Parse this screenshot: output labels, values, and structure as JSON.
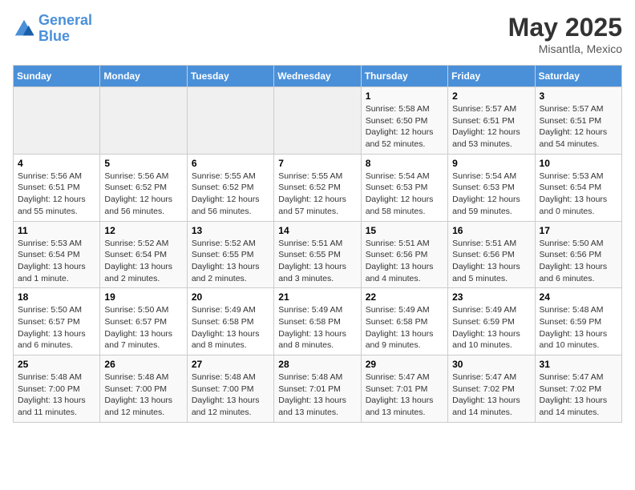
{
  "header": {
    "logo_line1": "General",
    "logo_line2": "Blue",
    "month_year": "May 2025",
    "location": "Misantla, Mexico"
  },
  "weekdays": [
    "Sunday",
    "Monday",
    "Tuesday",
    "Wednesday",
    "Thursday",
    "Friday",
    "Saturday"
  ],
  "weeks": [
    [
      {
        "day": "",
        "info": ""
      },
      {
        "day": "",
        "info": ""
      },
      {
        "day": "",
        "info": ""
      },
      {
        "day": "",
        "info": ""
      },
      {
        "day": "1",
        "info": "Sunrise: 5:58 AM\nSunset: 6:50 PM\nDaylight: 12 hours\nand 52 minutes."
      },
      {
        "day": "2",
        "info": "Sunrise: 5:57 AM\nSunset: 6:51 PM\nDaylight: 12 hours\nand 53 minutes."
      },
      {
        "day": "3",
        "info": "Sunrise: 5:57 AM\nSunset: 6:51 PM\nDaylight: 12 hours\nand 54 minutes."
      }
    ],
    [
      {
        "day": "4",
        "info": "Sunrise: 5:56 AM\nSunset: 6:51 PM\nDaylight: 12 hours\nand 55 minutes."
      },
      {
        "day": "5",
        "info": "Sunrise: 5:56 AM\nSunset: 6:52 PM\nDaylight: 12 hours\nand 56 minutes."
      },
      {
        "day": "6",
        "info": "Sunrise: 5:55 AM\nSunset: 6:52 PM\nDaylight: 12 hours\nand 56 minutes."
      },
      {
        "day": "7",
        "info": "Sunrise: 5:55 AM\nSunset: 6:52 PM\nDaylight: 12 hours\nand 57 minutes."
      },
      {
        "day": "8",
        "info": "Sunrise: 5:54 AM\nSunset: 6:53 PM\nDaylight: 12 hours\nand 58 minutes."
      },
      {
        "day": "9",
        "info": "Sunrise: 5:54 AM\nSunset: 6:53 PM\nDaylight: 12 hours\nand 59 minutes."
      },
      {
        "day": "10",
        "info": "Sunrise: 5:53 AM\nSunset: 6:54 PM\nDaylight: 13 hours\nand 0 minutes."
      }
    ],
    [
      {
        "day": "11",
        "info": "Sunrise: 5:53 AM\nSunset: 6:54 PM\nDaylight: 13 hours\nand 1 minute."
      },
      {
        "day": "12",
        "info": "Sunrise: 5:52 AM\nSunset: 6:54 PM\nDaylight: 13 hours\nand 2 minutes."
      },
      {
        "day": "13",
        "info": "Sunrise: 5:52 AM\nSunset: 6:55 PM\nDaylight: 13 hours\nand 2 minutes."
      },
      {
        "day": "14",
        "info": "Sunrise: 5:51 AM\nSunset: 6:55 PM\nDaylight: 13 hours\nand 3 minutes."
      },
      {
        "day": "15",
        "info": "Sunrise: 5:51 AM\nSunset: 6:56 PM\nDaylight: 13 hours\nand 4 minutes."
      },
      {
        "day": "16",
        "info": "Sunrise: 5:51 AM\nSunset: 6:56 PM\nDaylight: 13 hours\nand 5 minutes."
      },
      {
        "day": "17",
        "info": "Sunrise: 5:50 AM\nSunset: 6:56 PM\nDaylight: 13 hours\nand 6 minutes."
      }
    ],
    [
      {
        "day": "18",
        "info": "Sunrise: 5:50 AM\nSunset: 6:57 PM\nDaylight: 13 hours\nand 6 minutes."
      },
      {
        "day": "19",
        "info": "Sunrise: 5:50 AM\nSunset: 6:57 PM\nDaylight: 13 hours\nand 7 minutes."
      },
      {
        "day": "20",
        "info": "Sunrise: 5:49 AM\nSunset: 6:58 PM\nDaylight: 13 hours\nand 8 minutes."
      },
      {
        "day": "21",
        "info": "Sunrise: 5:49 AM\nSunset: 6:58 PM\nDaylight: 13 hours\nand 8 minutes."
      },
      {
        "day": "22",
        "info": "Sunrise: 5:49 AM\nSunset: 6:58 PM\nDaylight: 13 hours\nand 9 minutes."
      },
      {
        "day": "23",
        "info": "Sunrise: 5:49 AM\nSunset: 6:59 PM\nDaylight: 13 hours\nand 10 minutes."
      },
      {
        "day": "24",
        "info": "Sunrise: 5:48 AM\nSunset: 6:59 PM\nDaylight: 13 hours\nand 10 minutes."
      }
    ],
    [
      {
        "day": "25",
        "info": "Sunrise: 5:48 AM\nSunset: 7:00 PM\nDaylight: 13 hours\nand 11 minutes."
      },
      {
        "day": "26",
        "info": "Sunrise: 5:48 AM\nSunset: 7:00 PM\nDaylight: 13 hours\nand 12 minutes."
      },
      {
        "day": "27",
        "info": "Sunrise: 5:48 AM\nSunset: 7:00 PM\nDaylight: 13 hours\nand 12 minutes."
      },
      {
        "day": "28",
        "info": "Sunrise: 5:48 AM\nSunset: 7:01 PM\nDaylight: 13 hours\nand 13 minutes."
      },
      {
        "day": "29",
        "info": "Sunrise: 5:47 AM\nSunset: 7:01 PM\nDaylight: 13 hours\nand 13 minutes."
      },
      {
        "day": "30",
        "info": "Sunrise: 5:47 AM\nSunset: 7:02 PM\nDaylight: 13 hours\nand 14 minutes."
      },
      {
        "day": "31",
        "info": "Sunrise: 5:47 AM\nSunset: 7:02 PM\nDaylight: 13 hours\nand 14 minutes."
      }
    ]
  ]
}
